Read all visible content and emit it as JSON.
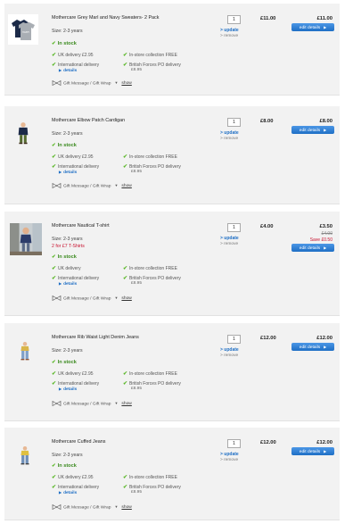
{
  "labels": {
    "update": "> update",
    "remove": "> remove",
    "in_stock": "In stock",
    "uk_delivery": "UK delivery",
    "international": "International delivery",
    "details": "details",
    "instore": "In-store collection",
    "free": "FREE",
    "bfpo": "British Forces PO delivery",
    "gift": "Gift Message / Gift Wrap",
    "show": "show",
    "edit": "edit details"
  },
  "items": [
    {
      "name": "Mothercare Grey Marl and Navy Sweaters- 2 Pack",
      "size": "Size: 2-3 years",
      "promo": "",
      "qty": "1",
      "unit_price": "£11.00",
      "total": "£11.00",
      "was": "",
      "save": "",
      "uk_price": "£2.95",
      "bfpo_price": "£8.95",
      "thumb_icon": "sweaters-product-image"
    },
    {
      "name": "Mothercare Elbow Patch Cardigan",
      "size": "Size: 2-3 years",
      "promo": "",
      "qty": "1",
      "unit_price": "£8.00",
      "total": "£8.00",
      "was": "",
      "save": "",
      "uk_price": "£2.95",
      "bfpo_price": "£8.95",
      "thumb_icon": "cardigan-product-image"
    },
    {
      "name": "Mothercare Nautical T-shirt",
      "size": "Size: 2-3 years",
      "promo": "2 for £7 T-Shirts",
      "qty": "1",
      "unit_price": "£4.00",
      "total": "£3.50",
      "was": "£4.00",
      "save": "Save £0.50",
      "uk_price": "",
      "bfpo_price": "£8.95",
      "thumb_icon": "tshirt-product-image"
    },
    {
      "name": "Mothercare Rib Waist Light Denim Jeans",
      "size": "Size: 2-3 years",
      "promo": "",
      "qty": "1",
      "unit_price": "£12.00",
      "total": "£12.00",
      "was": "",
      "save": "",
      "uk_price": "£2.95",
      "bfpo_price": "£8.95",
      "thumb_icon": "jeans-product-image"
    },
    {
      "name": "Mothercare Cuffed Jeans",
      "size": "Size: 2-3 years",
      "promo": "",
      "qty": "1",
      "unit_price": "£12.00",
      "total": "£12.00",
      "was": "",
      "save": "",
      "uk_price": "£2.95",
      "bfpo_price": "£8.95",
      "thumb_icon": "cuffed-jeans-product-image"
    }
  ],
  "colors": {
    "link": "#1f6fc5",
    "stock_green": "#3a8a1e",
    "promo_red": "#c8102e",
    "button_blue": "#1f6fc5",
    "row_bg": "#f2f2f2"
  }
}
